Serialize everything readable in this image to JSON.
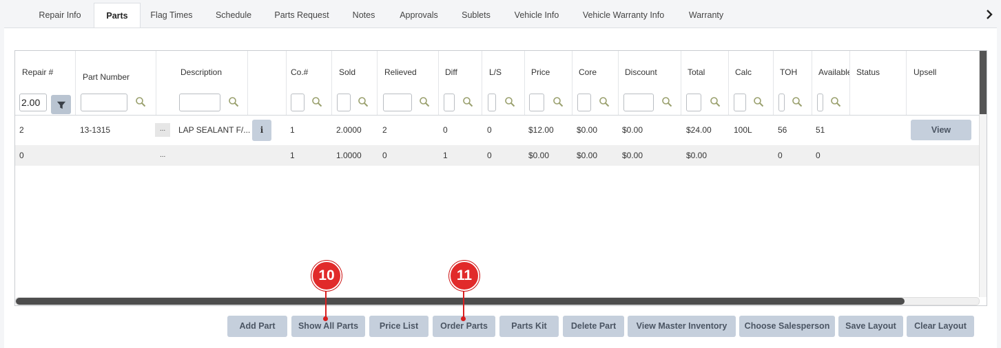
{
  "tabs": [
    "Repair Info",
    "Parts",
    "Flag Times",
    "Schedule",
    "Parts Request",
    "Notes",
    "Approvals",
    "Sublets",
    "Vehicle Info",
    "Vehicle Warranty Info",
    "Warranty"
  ],
  "active_tab": "Parts",
  "columns": {
    "repair_no": "Repair #",
    "part_number": "Part Number",
    "description": "Description",
    "co_no": "Co.#",
    "sold": "Sold",
    "relieved": "Relieved",
    "diff": "Diff",
    "ls": "L/S",
    "price": "Price",
    "core": "Core",
    "discount": "Discount",
    "total": "Total",
    "calc": "Calc",
    "toh": "TOH",
    "available": "Available",
    "status": "Status",
    "upsell": "Upsell"
  },
  "filter": {
    "repair_no_value": "2.00"
  },
  "rows": [
    {
      "repair_no": "2",
      "part_number": "13-1315",
      "ellipsis": "...",
      "description": "LAP SEALANT F/...",
      "info": "i",
      "co_no": "1",
      "sold": "2.0000",
      "relieved": "2",
      "diff": "0",
      "ls": "0",
      "price": "$12.00",
      "core": "$0.00",
      "discount": "$0.00",
      "total": "$24.00",
      "calc": "100L",
      "toh": "56",
      "available": "51",
      "upsell_button": "View"
    },
    {
      "repair_no": "0",
      "part_number": "",
      "ellipsis": "...",
      "description": "",
      "co_no": "1",
      "sold": "1.0000",
      "relieved": "0",
      "diff": "1",
      "ls": "0",
      "price": "$0.00",
      "core": "$0.00",
      "discount": "$0.00",
      "total": "$0.00",
      "calc": "",
      "toh": "0",
      "available": "0"
    }
  ],
  "buttons": {
    "add_part": "Add Part",
    "show_all_parts": "Show All Parts",
    "price_list": "Price List",
    "order_parts": "Order Parts",
    "parts_kit": "Parts Kit",
    "delete_part": "Delete Part",
    "view_master_inventory": "View Master Inventory",
    "choose_salesperson": "Choose Salesperson",
    "save_layout": "Save Layout",
    "clear_layout": "Clear Layout"
  },
  "callouts": [
    "10",
    "11"
  ],
  "colors": {
    "button_bg": "#c5cfdc",
    "callout_red": "#e12a2a",
    "scrollbar": "#4d4d4d"
  }
}
